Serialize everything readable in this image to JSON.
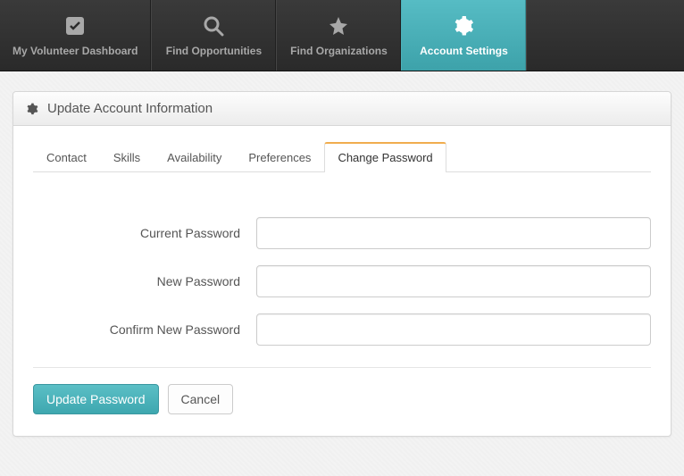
{
  "nav": {
    "items": [
      {
        "label": "My Volunteer Dashboard"
      },
      {
        "label": "Find Opportunities"
      },
      {
        "label": "Find Organizations"
      },
      {
        "label": "Account Settings"
      }
    ],
    "active_index": 3
  },
  "panel": {
    "title": "Update Account Information"
  },
  "tabs": {
    "items": [
      {
        "label": "Contact"
      },
      {
        "label": "Skills"
      },
      {
        "label": "Availability"
      },
      {
        "label": "Preferences"
      },
      {
        "label": "Change Password"
      }
    ],
    "active_index": 4
  },
  "form": {
    "current_password": {
      "label": "Current Password",
      "value": ""
    },
    "new_password": {
      "label": "New Password",
      "value": ""
    },
    "confirm_password": {
      "label": "Confirm New Password",
      "value": ""
    }
  },
  "actions": {
    "submit_label": "Update Password",
    "cancel_label": "Cancel"
  },
  "colors": {
    "accent": "#4bb0b8",
    "tab_active_top": "#f0ad4e"
  }
}
